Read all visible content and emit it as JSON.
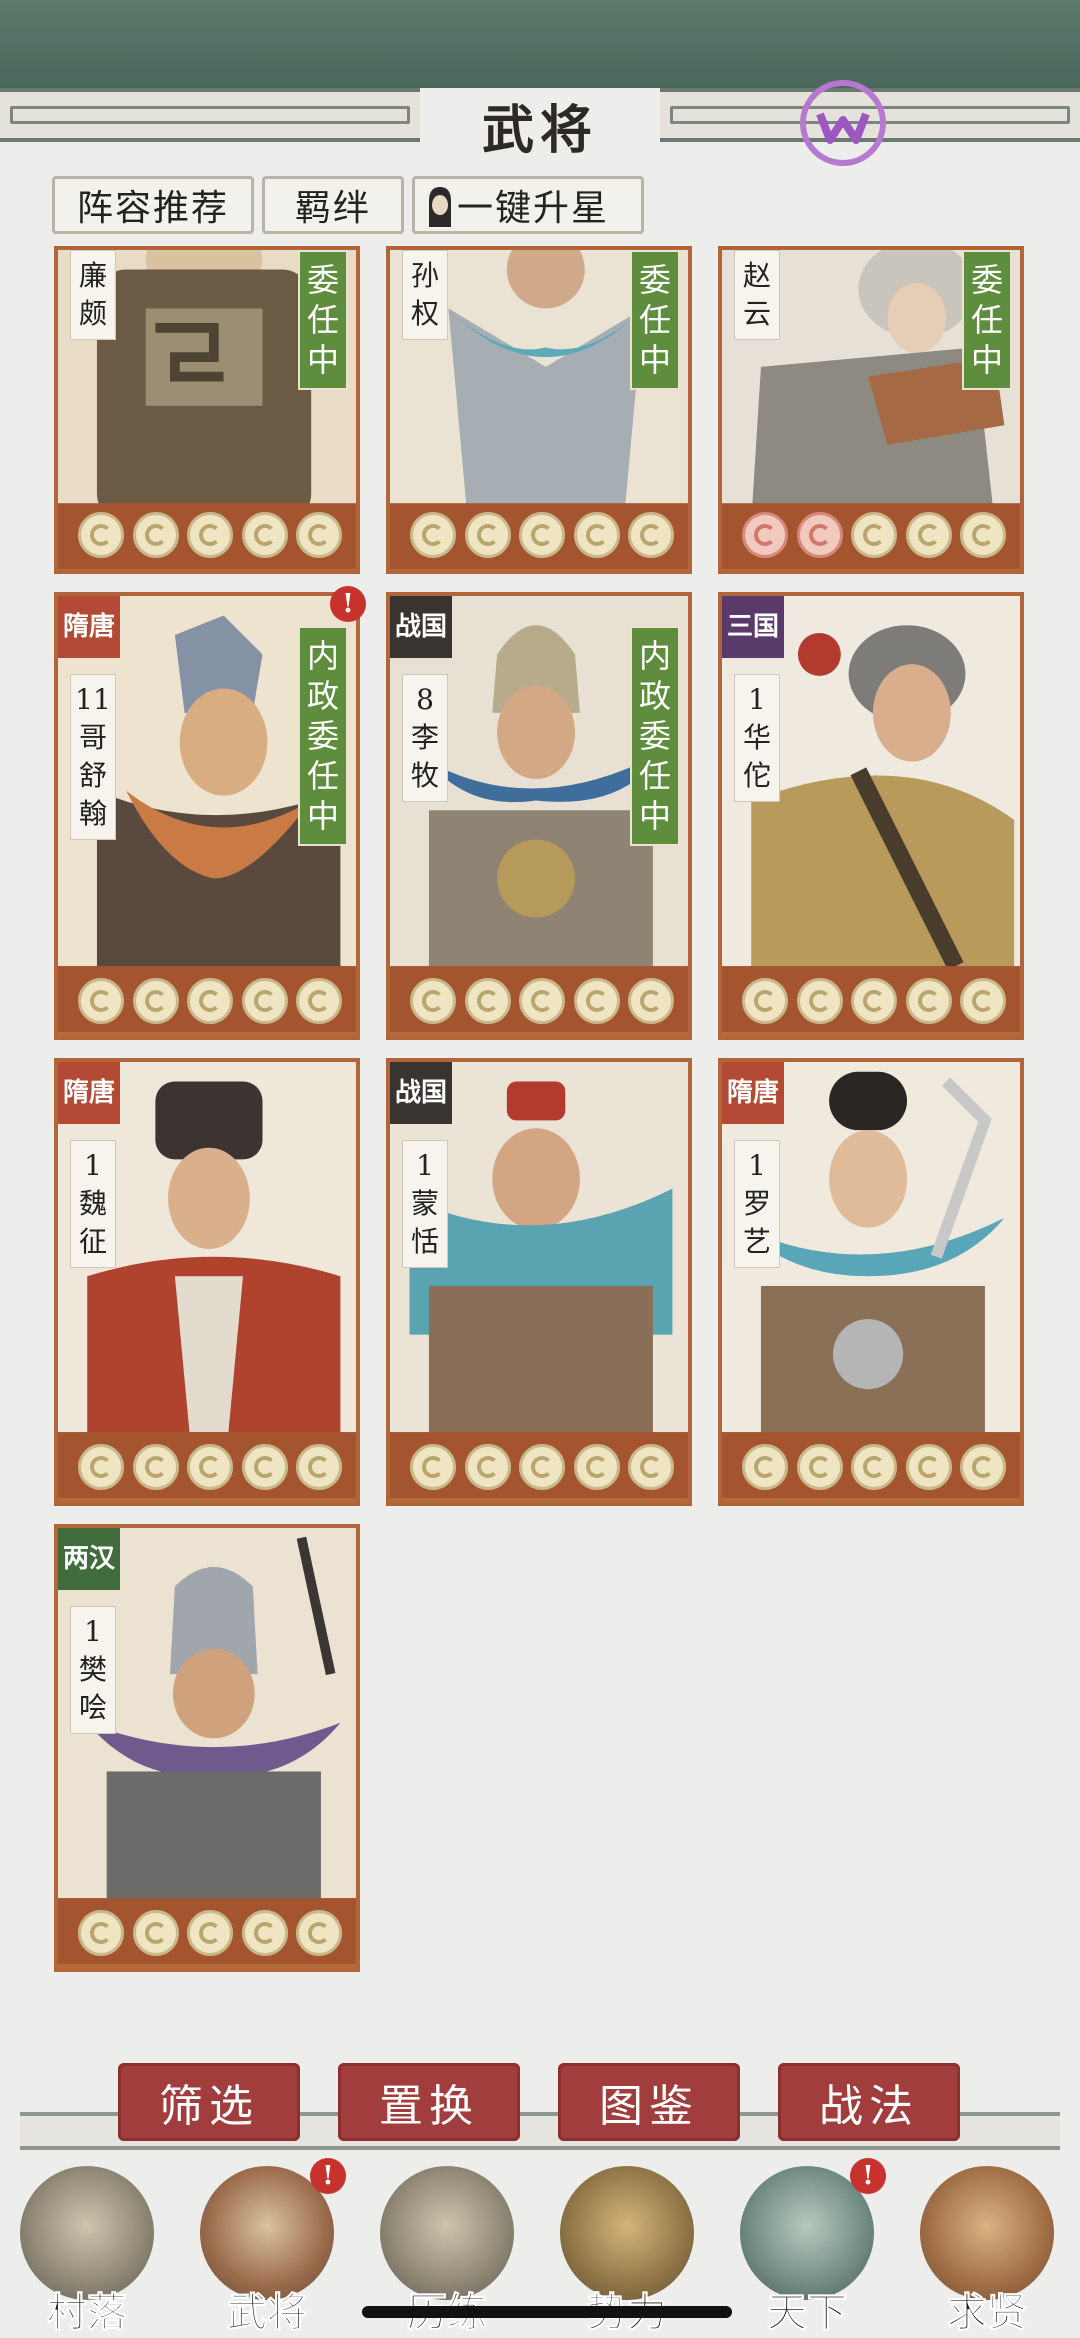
{
  "header": {
    "title": "武将"
  },
  "toolbar": {
    "lineup": "阵容推荐",
    "bond": "羁绊",
    "star_up": "一键升星"
  },
  "cards": [
    {
      "name": "廉颇",
      "status": "委任中",
      "stars_red": 0
    },
    {
      "name": "孙权",
      "status": "委任中",
      "stars_red": 0
    },
    {
      "name": "赵云",
      "status": "委任中",
      "stars_red": 2
    },
    {
      "era": "隋唐",
      "level": "11",
      "name": "哥舒翰",
      "status": "内政委任中",
      "alert": "!"
    },
    {
      "era": "战国",
      "level": "8",
      "name": "李牧",
      "status": "内政委任中"
    },
    {
      "era": "三国",
      "level": "1",
      "name": "华佗"
    },
    {
      "era": "隋唐",
      "level": "1",
      "name": "魏征"
    },
    {
      "era": "战国",
      "level": "1",
      "name": "蒙恬"
    },
    {
      "era": "隋唐",
      "level": "1",
      "name": "罗艺"
    },
    {
      "era": "两汉",
      "level": "1",
      "name": "樊哙"
    }
  ],
  "actions": {
    "filter": "筛选",
    "replace": "置换",
    "codex": "图鉴",
    "tactics": "战法"
  },
  "nav": [
    {
      "label": "村落",
      "icon": "compass-icon"
    },
    {
      "label": "武将",
      "icon": "helmet-icon",
      "alert": "!"
    },
    {
      "label": "历练",
      "icon": "crossed-swords-icon"
    },
    {
      "label": "势力",
      "icon": "bronze-vessel-icon"
    },
    {
      "label": "天下",
      "icon": "jade-seal-icon",
      "alert": "!"
    },
    {
      "label": "求贤",
      "icon": "turtle-shell-icon"
    }
  ],
  "colors": {
    "accent_red": "#a13d3d",
    "status_green": "#5f8d3e",
    "card_frame": "#b0653a",
    "era_suitang": "#b24a35",
    "era_zhanguo": "#3a3431",
    "era_sanguo": "#5a3a6b",
    "era_lianghan": "#3f6b3d"
  }
}
